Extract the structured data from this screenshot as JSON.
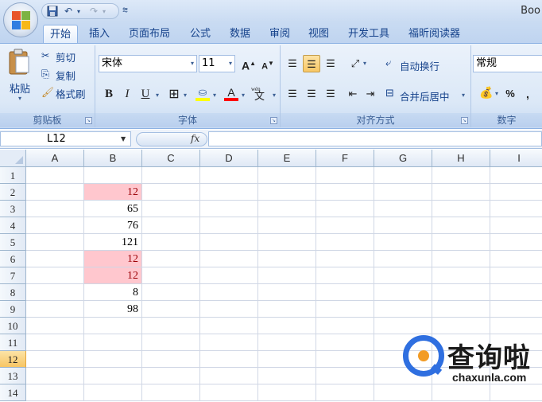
{
  "window": {
    "title": "Boo"
  },
  "quick_access": {
    "customize": "⩬"
  },
  "tabs": [
    {
      "label": "开始",
      "active": true
    },
    {
      "label": "插入"
    },
    {
      "label": "页面布局"
    },
    {
      "label": "公式"
    },
    {
      "label": "数据"
    },
    {
      "label": "审阅"
    },
    {
      "label": "视图"
    },
    {
      "label": "开发工具"
    },
    {
      "label": "福昕阅读器"
    }
  ],
  "ribbon": {
    "clipboard": {
      "paste": "粘贴",
      "cut": "剪切",
      "copy": "复制",
      "format_painter": "格式刷",
      "group_label": "剪贴板"
    },
    "font": {
      "name": "宋体",
      "size": "11",
      "grow": "A",
      "shrink": "A",
      "bold": "B",
      "italic": "I",
      "underline": "U",
      "font_color_glyph": "A",
      "phonetic": "wén",
      "group_label": "字体",
      "fill_color": "#ffff00",
      "text_color": "#ff0000"
    },
    "alignment": {
      "wrap_text": "自动换行",
      "merge_center": "合并后居中",
      "group_label": "对齐方式"
    },
    "number": {
      "format": "常规",
      "percent": "%",
      "comma": ",",
      "group_label": "数字"
    }
  },
  "formula_bar": {
    "name_box": "L12",
    "fx": "fx",
    "formula": ""
  },
  "sheet": {
    "columns": [
      "A",
      "B",
      "C",
      "D",
      "E",
      "F",
      "G",
      "H",
      "I"
    ],
    "rows": [
      "1",
      "2",
      "3",
      "4",
      "5",
      "6",
      "7",
      "8",
      "9",
      "10",
      "11",
      "12",
      "13",
      "14"
    ],
    "selected_row": "12",
    "column_b": [
      "",
      "12",
      "65",
      "76",
      "121",
      "12",
      "12",
      "8",
      "98"
    ],
    "highlighted_rows": [
      2,
      6,
      7
    ],
    "highlight_fill": "#ffc7ce",
    "highlight_text": "#9c0006"
  },
  "watermark": {
    "cn": "查询啦",
    "en": "chaxunla.com"
  }
}
